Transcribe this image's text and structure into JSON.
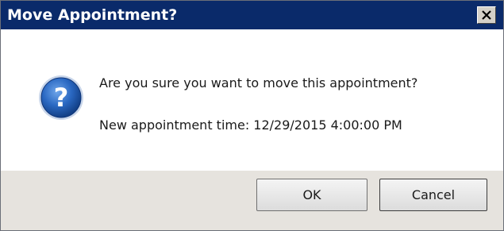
{
  "window": {
    "title": "Move Appointment?",
    "close_icon": "close-icon"
  },
  "message": {
    "icon": "question-icon",
    "line1": "Are you sure you want to move this appointment?",
    "line2": "New appointment time: 12/29/2015 4:00:00 PM"
  },
  "buttons": {
    "ok_label": "OK",
    "cancel_label": "Cancel"
  },
  "colors": {
    "titlebar": "#0a2a6a",
    "button_bar": "#e6e3de",
    "icon_blue": "#1f5fb8"
  }
}
